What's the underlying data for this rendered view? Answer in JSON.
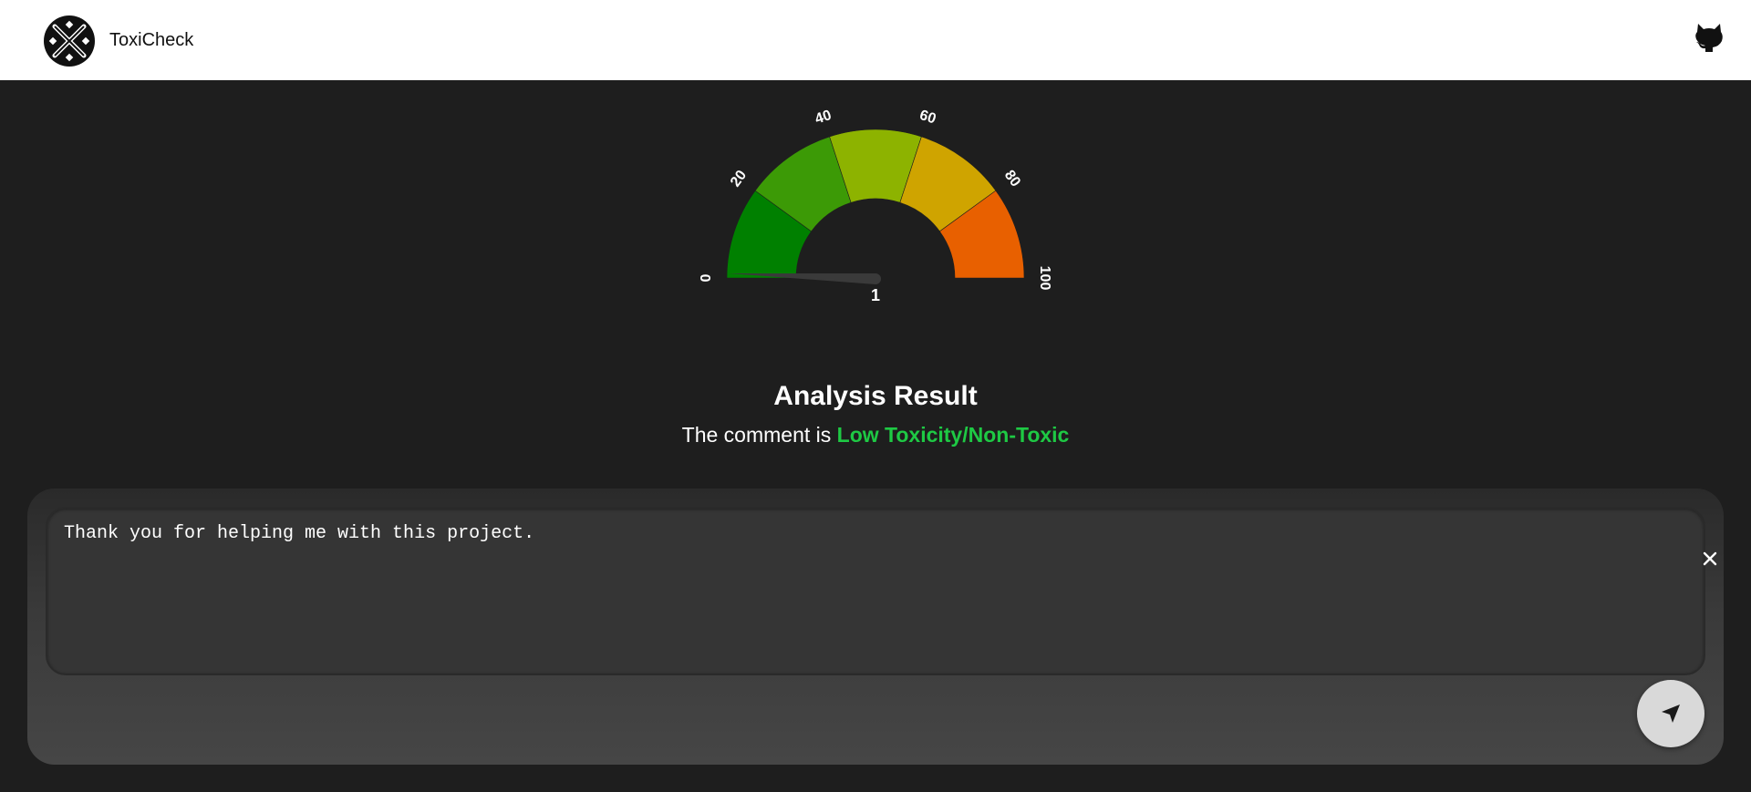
{
  "header": {
    "brand": "ToxiCheck",
    "logo_icon": "crossed-swords-logo-icon",
    "github_icon": "github-octocat-icon"
  },
  "gauge": {
    "min": 0,
    "max": 100,
    "value": 1,
    "value_label": "1",
    "tick_labels": [
      "0",
      "20",
      "40",
      "60",
      "80",
      "100"
    ],
    "segment_colors": [
      "#008000",
      "#3c9a06",
      "#8db300",
      "#cfa400",
      "#e86000"
    ],
    "needle_color": "#3a3a3a"
  },
  "result": {
    "title": "Analysis Result",
    "prefix": "The comment is",
    "status": "Low Toxicity/Non-Toxic",
    "status_color": "#1ec944"
  },
  "input": {
    "text": "Thank you for helping me with this project.",
    "clear_icon": "close-icon",
    "send_icon": "send-arrow-icon"
  }
}
